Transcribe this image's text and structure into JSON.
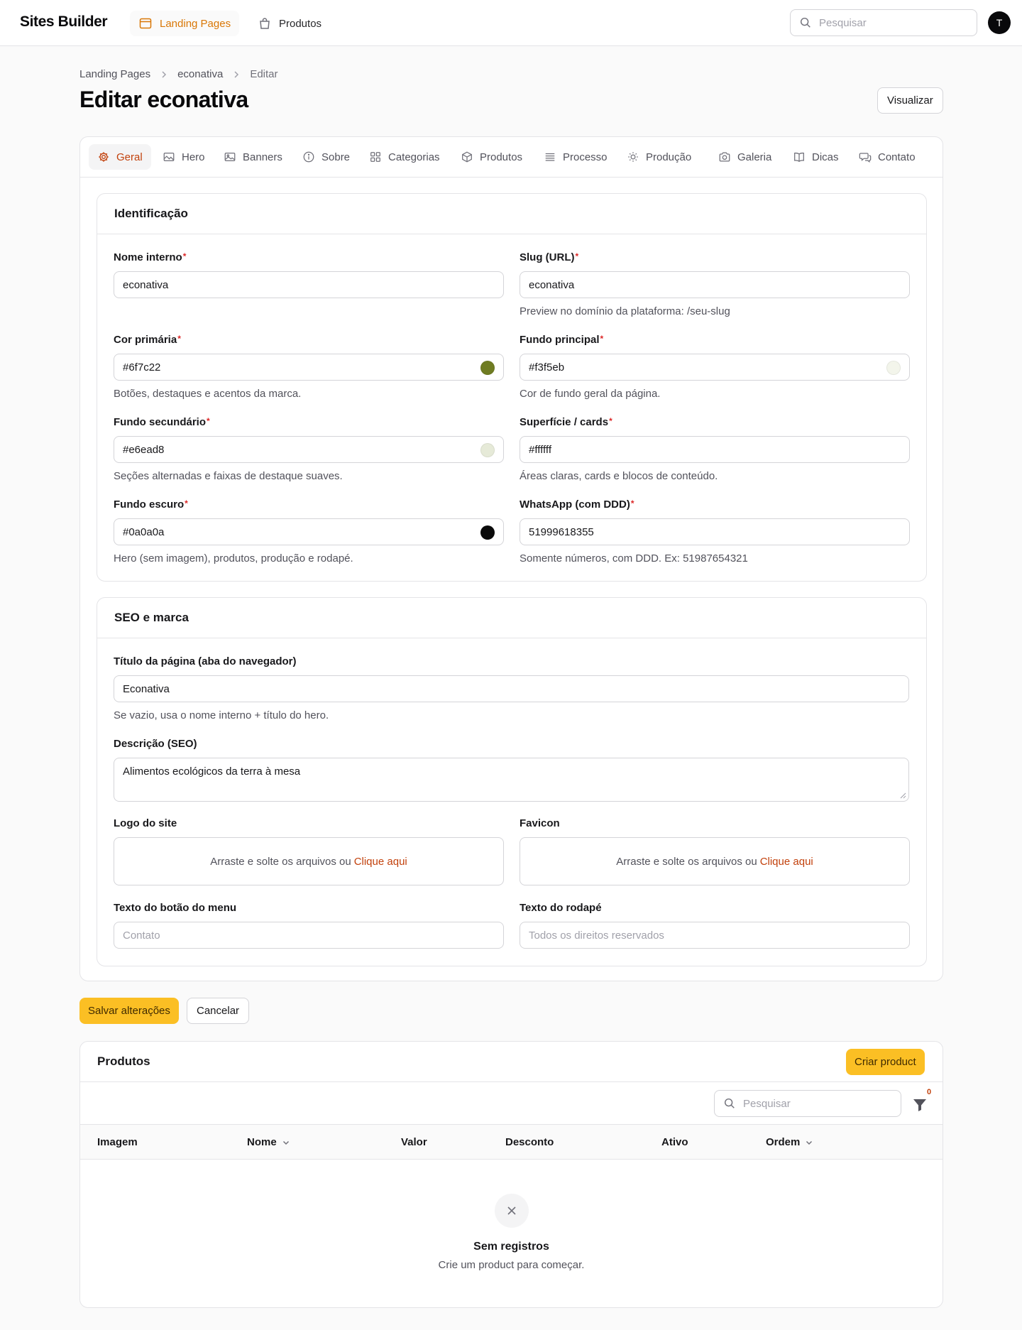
{
  "app": {
    "brand": "Sites Builder",
    "avatar_initial": "T"
  },
  "nav": {
    "items": [
      {
        "label": "Landing Pages",
        "icon": "window-icon",
        "active": true
      },
      {
        "label": "Produtos",
        "icon": "shopping-bag-icon",
        "active": false
      }
    ],
    "search_placeholder": "Pesquisar"
  },
  "breadcrumb": [
    "Landing Pages",
    "econativa",
    "Editar"
  ],
  "page": {
    "title": "Editar econativa",
    "preview_button": "Visualizar"
  },
  "tabs": [
    {
      "label": "Geral",
      "icon": "gear-icon",
      "active": true
    },
    {
      "label": "Hero",
      "icon": "image-icon"
    },
    {
      "label": "Banners",
      "icon": "photo-icon"
    },
    {
      "label": "Sobre",
      "icon": "info-icon"
    },
    {
      "label": "Categorias",
      "icon": "squares-icon"
    },
    {
      "label": "Produtos",
      "icon": "cube-icon"
    },
    {
      "label": "Processo",
      "icon": "list-icon"
    },
    {
      "label": "Produção",
      "icon": "sun-icon"
    },
    {
      "label": "Galeria",
      "icon": "camera-icon"
    },
    {
      "label": "Dicas",
      "icon": "book-icon"
    },
    {
      "label": "Contato",
      "icon": "chat-icon"
    }
  ],
  "identificacao": {
    "title": "Identificação",
    "nome_interno": {
      "label": "Nome interno",
      "value": "econativa"
    },
    "slug": {
      "label": "Slug (URL)",
      "value": "econativa",
      "hint": "Preview no domínio da plataforma: /seu-slug"
    },
    "cor_primaria": {
      "label": "Cor primária",
      "value": "#6f7c22",
      "hint": "Botões, destaques e acentos da marca.",
      "swatch": "#6f7c22"
    },
    "fundo_principal": {
      "label": "Fundo principal",
      "value": "#f3f5eb",
      "hint": "Cor de fundo geral da página.",
      "swatch": "#f3f5eb"
    },
    "fundo_secundario": {
      "label": "Fundo secundário",
      "value": "#e6ead8",
      "hint": "Seções alternadas e faixas de destaque suaves.",
      "swatch": "#e6ead8"
    },
    "superficie": {
      "label": "Superfície / cards",
      "value": "#ffffff",
      "hint": "Áreas claras, cards e blocos de conteúdo.",
      "swatch": "#ffffff"
    },
    "fundo_escuro": {
      "label": "Fundo escuro",
      "value": "#0a0a0a",
      "hint": "Hero (sem imagem), produtos, produção e rodapé.",
      "swatch": "#0a0a0a"
    },
    "whatsapp": {
      "label": "WhatsApp (com DDD)",
      "value": "51999618355",
      "hint": "Somente números, com DDD. Ex: 51987654321"
    }
  },
  "seo": {
    "title": "SEO e marca",
    "titulo_pagina": {
      "label": "Título da página (aba do navegador)",
      "value": "Econativa",
      "hint": "Se vazio, usa o nome interno + título do hero."
    },
    "descricao": {
      "label": "Descrição (SEO)",
      "value": "Alimentos ecológicos da terra à mesa"
    },
    "logo": {
      "label": "Logo do site",
      "text": "Arraste e solte os arquivos ou",
      "link": "Clique aqui"
    },
    "favicon": {
      "label": "Favicon",
      "text": "Arraste e solte os arquivos ou",
      "link": "Clique aqui"
    },
    "texto_botao_menu": {
      "label": "Texto do botão do menu",
      "placeholder": "Contato"
    },
    "texto_rodape": {
      "label": "Texto do rodapé",
      "placeholder": "Todos os direitos reservados"
    }
  },
  "actions": {
    "save": "Salvar alterações",
    "cancel": "Cancelar"
  },
  "produtos": {
    "title": "Produtos",
    "create_button": "Criar product",
    "search_placeholder": "Pesquisar",
    "filter_count": "0",
    "columns": [
      "Imagem",
      "Nome",
      "Valor",
      "Desconto",
      "Ativo",
      "Ordem"
    ],
    "empty_title": "Sem registros",
    "empty_subtitle": "Crie um product para começar."
  },
  "colors": {
    "accent": "#d97706",
    "primary_button": "#fbbf24",
    "required": "#dc2626"
  }
}
